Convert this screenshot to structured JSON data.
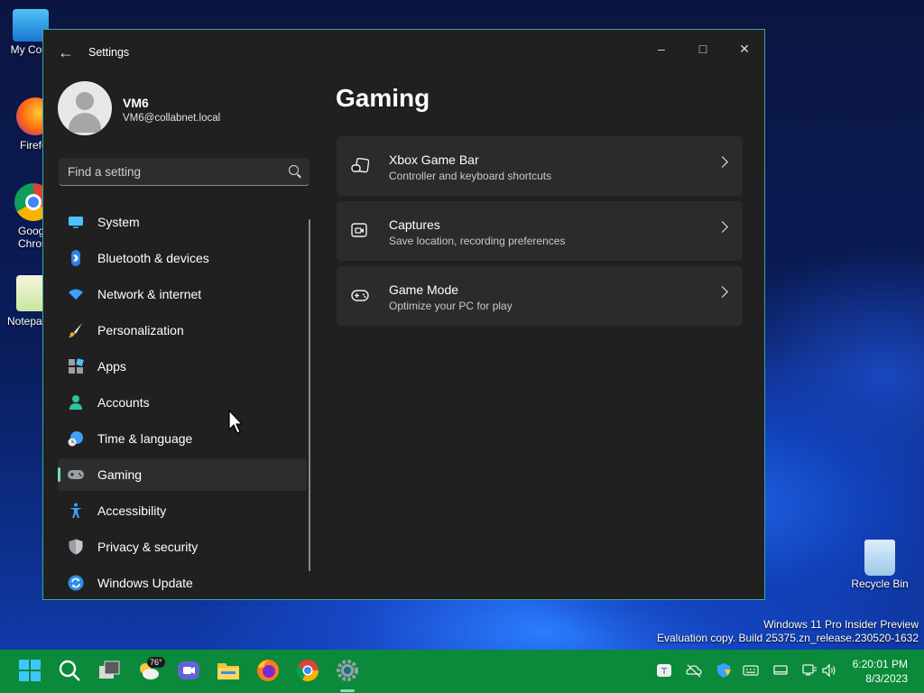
{
  "desktop": {
    "icons": [
      {
        "label": "My Com"
      },
      {
        "label": "Firefo"
      },
      {
        "label": "Goog\nChron"
      },
      {
        "label": "Notepa"
      },
      {
        "label": "Recycle Bin"
      }
    ],
    "watermark": {
      "line1": "Windows 11 Pro Insider Preview",
      "line2": "Evaluation copy. Build 25375.zn_release.230520-1632"
    }
  },
  "window": {
    "title": "Settings",
    "controls": {
      "minimize": "–",
      "maximize": "□",
      "close": "✕"
    },
    "user": {
      "name": "VM6",
      "email": "VM6@collabnet.local"
    },
    "search": {
      "placeholder": "Find a setting"
    },
    "nav": [
      {
        "label": "System",
        "icon": "system-icon"
      },
      {
        "label": "Bluetooth & devices",
        "icon": "bluetooth-icon"
      },
      {
        "label": "Network & internet",
        "icon": "wifi-icon"
      },
      {
        "label": "Personalization",
        "icon": "brush-icon"
      },
      {
        "label": "Apps",
        "icon": "apps-icon"
      },
      {
        "label": "Accounts",
        "icon": "person-icon"
      },
      {
        "label": "Time & language",
        "icon": "globe-clock-icon"
      },
      {
        "label": "Gaming",
        "icon": "gamepad-icon",
        "active": true
      },
      {
        "label": "Accessibility",
        "icon": "accessibility-icon"
      },
      {
        "label": "Privacy & security",
        "icon": "shield-icon"
      },
      {
        "label": "Windows Update",
        "icon": "update-icon"
      }
    ],
    "page": {
      "title": "Gaming",
      "cards": [
        {
          "title": "Xbox Game Bar",
          "subtitle": "Controller and keyboard shortcuts",
          "icon": "game-bar-icon"
        },
        {
          "title": "Captures",
          "subtitle": "Save location, recording preferences",
          "icon": "capture-icon"
        },
        {
          "title": "Game Mode",
          "subtitle": "Optimize your PC for play",
          "icon": "game-mode-icon"
        }
      ]
    }
  },
  "taskbar": {
    "weather_badge": "76°",
    "clock": {
      "time": "6:20:01 PM",
      "date": "8/3/2023"
    },
    "accent": "#4cc2ff"
  }
}
